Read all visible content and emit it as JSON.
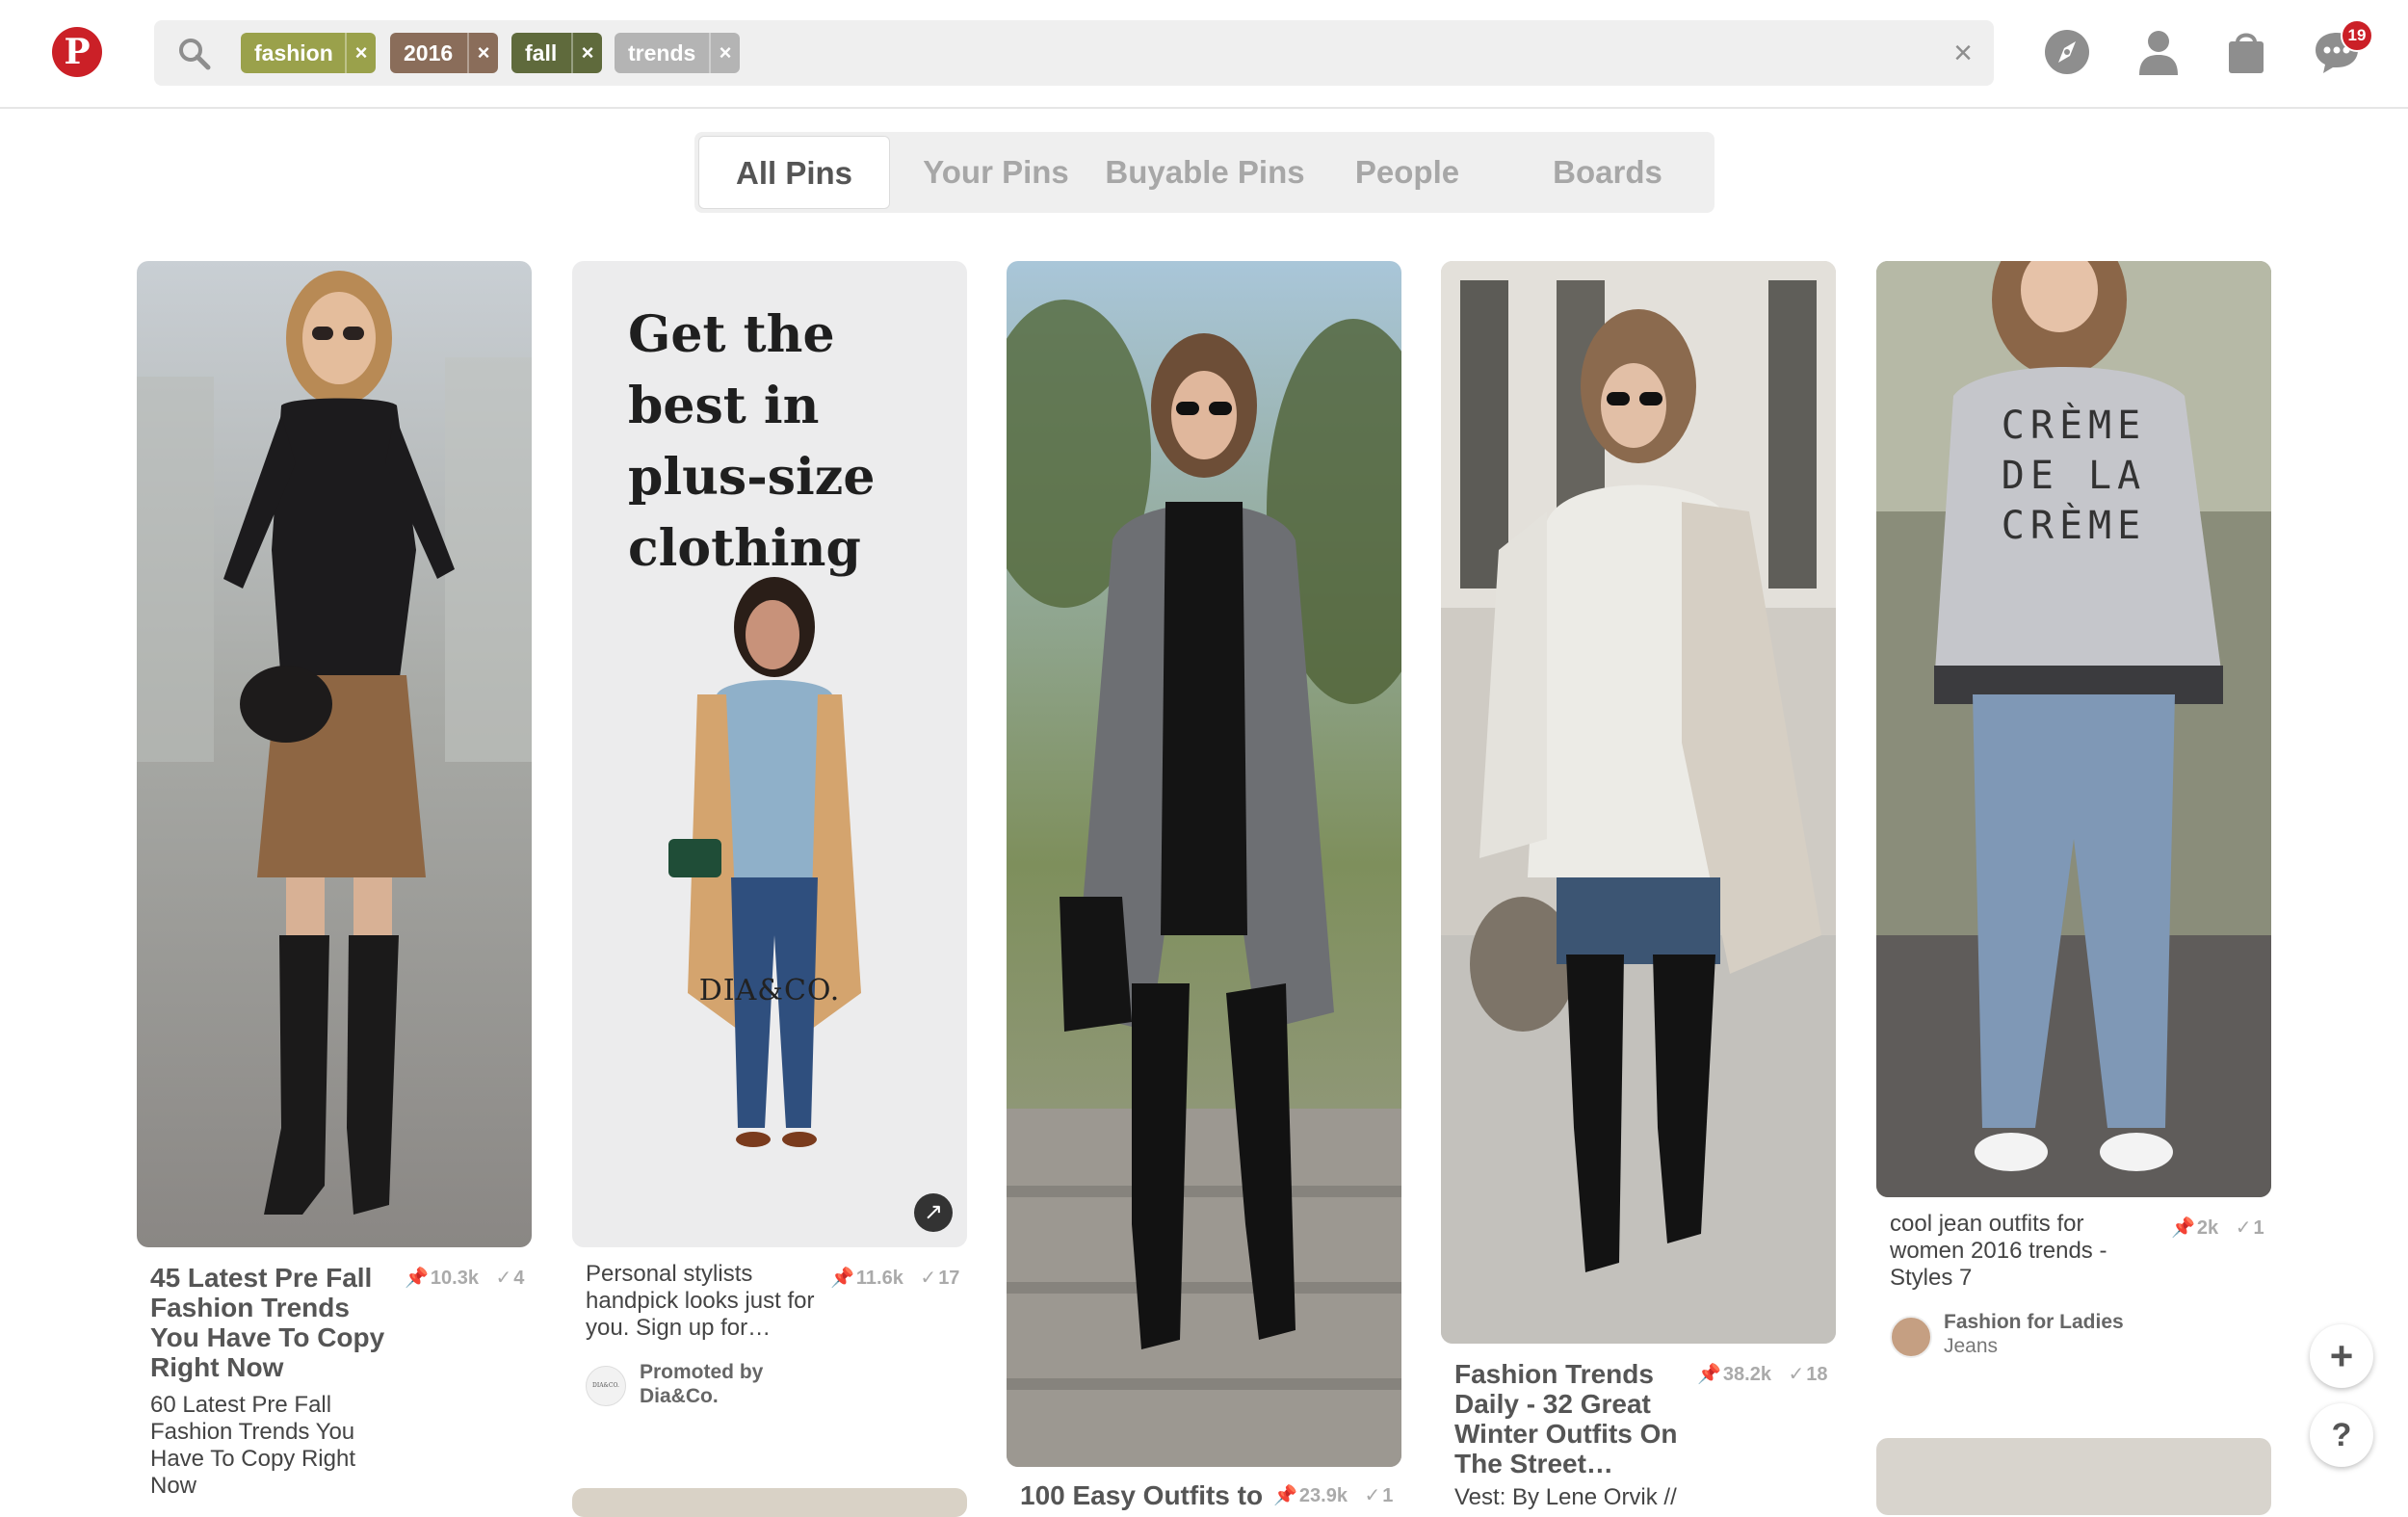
{
  "header": {
    "logo_letter": "P",
    "tags": [
      {
        "label": "fashion",
        "color": "#9aa14b"
      },
      {
        "label": "2016",
        "color": "#8a6d5a"
      },
      {
        "label": "fall",
        "color": "#5f6a3c"
      },
      {
        "label": "trends",
        "color": "#b4b4b4"
      }
    ],
    "clear_symbol": "×",
    "tag_remove_symbol": "×",
    "notification_count": "19",
    "icons": [
      "compass-icon",
      "profile-icon",
      "shopping-bag-icon",
      "messages-icon"
    ]
  },
  "tabs": [
    {
      "label": "All Pins",
      "active": true
    },
    {
      "label": "Your Pins",
      "active": false
    },
    {
      "label": "Buyable Pins",
      "active": false
    },
    {
      "label": "People",
      "active": false
    },
    {
      "label": "Boards",
      "active": false
    }
  ],
  "pins": [
    {
      "title": "45 Latest Pre Fall Fashion Trends You Have To Copy Right Now",
      "description": "60 Latest Pre Fall Fashion Trends You Have To Copy Right Now",
      "repins": "10.3k",
      "likes": "4"
    },
    {
      "ad_headline": "Get the best in plus-size clothing",
      "ad_brand": "DIA&CO.",
      "description": "Personal stylists handpick looks just for you. Sign up for…",
      "repins": "11.6k",
      "likes": "17",
      "promoted_label": "Promoted by",
      "promoted_by": "Dia&Co.",
      "avatar_text": "DIA&CO."
    },
    {
      "title": "100 Easy Outfits to",
      "repins": "23.9k",
      "likes": "1"
    },
    {
      "title": "Fashion Trends Daily - 32 Great Winter Outfits On The Street…",
      "description": "Vest: By Lene Orvik //",
      "repins": "38.2k",
      "likes": "18"
    },
    {
      "description": "cool jean outfits for women 2016 trends - Styles 7",
      "repins": "2k",
      "likes": "1",
      "board_user": "Fashion for Ladies",
      "board_name": "Jeans",
      "sweater_text": [
        "CRÈME",
        "DE LA",
        "CRÈME"
      ]
    }
  ],
  "floating": {
    "add_symbol": "+",
    "help_symbol": "?"
  }
}
